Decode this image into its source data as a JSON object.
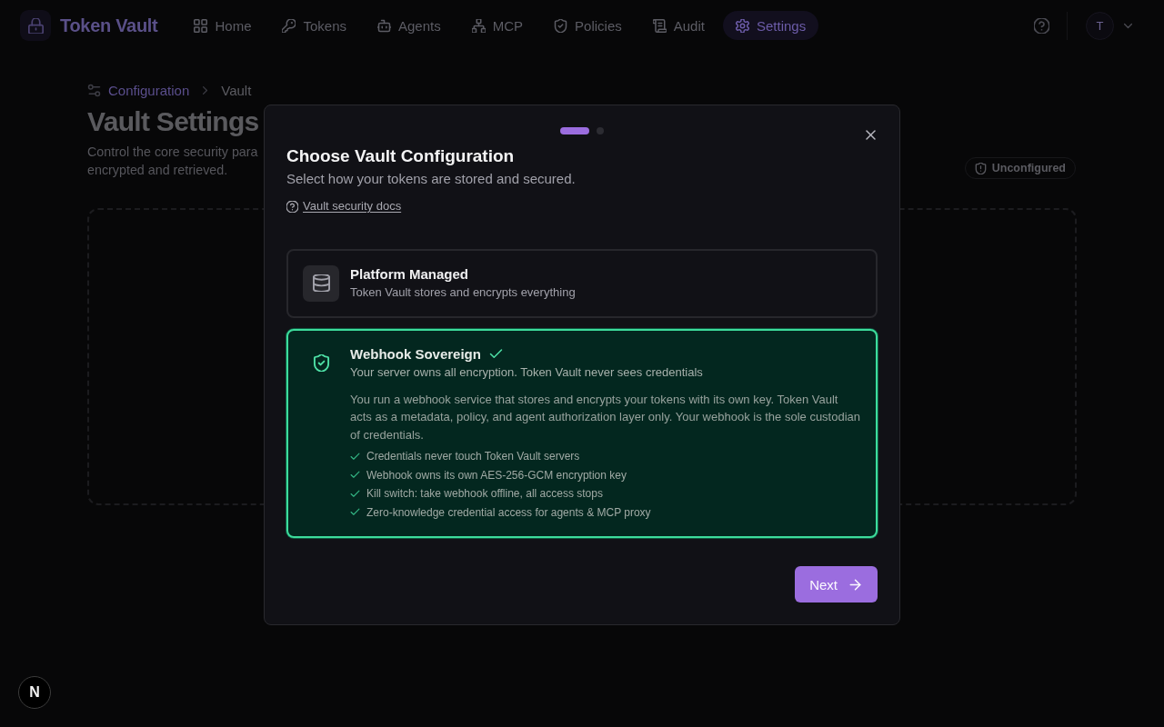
{
  "app_bar": {
    "brand": "Token Vault",
    "nav": [
      {
        "label": "Home",
        "selected": false
      },
      {
        "label": "Tokens",
        "selected": false
      },
      {
        "label": "Agents",
        "selected": false
      },
      {
        "label": "MCP",
        "selected": false
      },
      {
        "label": "Policies",
        "selected": false
      },
      {
        "label": "Audit",
        "selected": false
      },
      {
        "label": "Settings",
        "selected": true
      }
    ],
    "avatar_initial": "T"
  },
  "page": {
    "breadcrumb": [
      "Configuration",
      "Vault"
    ],
    "title": "Vault Settings",
    "description_lines": [
      "Control the core security para",
      "encrypted and retrieved."
    ],
    "status_badge": "Unconfigured"
  },
  "dialog": {
    "steps": [
      {
        "selected": true
      },
      {
        "selected": false
      }
    ],
    "title": "Choose Vault Configuration",
    "subtitle": "Select how your tokens are stored and secured.",
    "docs_link": "Vault security docs",
    "options": [
      {
        "title": "Platform Managed",
        "description": "Token Vault stores and encrypts everything",
        "selected": false
      },
      {
        "title": "Webhook Sovereign",
        "description": "Your server owns all encryption. Token Vault never sees credentials",
        "selected": true,
        "details": "You run a webhook service that stores and encrypts your tokens with its own key. Token Vault acts as a metadata, policy, and agent authorization layer only. Your webhook is the sole custodian of credentials.",
        "features": [
          "Credentials never touch Token Vault servers",
          "Webhook owns its own AES-256-GCM encryption key",
          "Kill switch: take webhook offline, all access stops",
          "Zero-knowledge credential access for agents & MCP proxy"
        ]
      }
    ],
    "next_button": "Next"
  },
  "dev_indicator": "N"
}
